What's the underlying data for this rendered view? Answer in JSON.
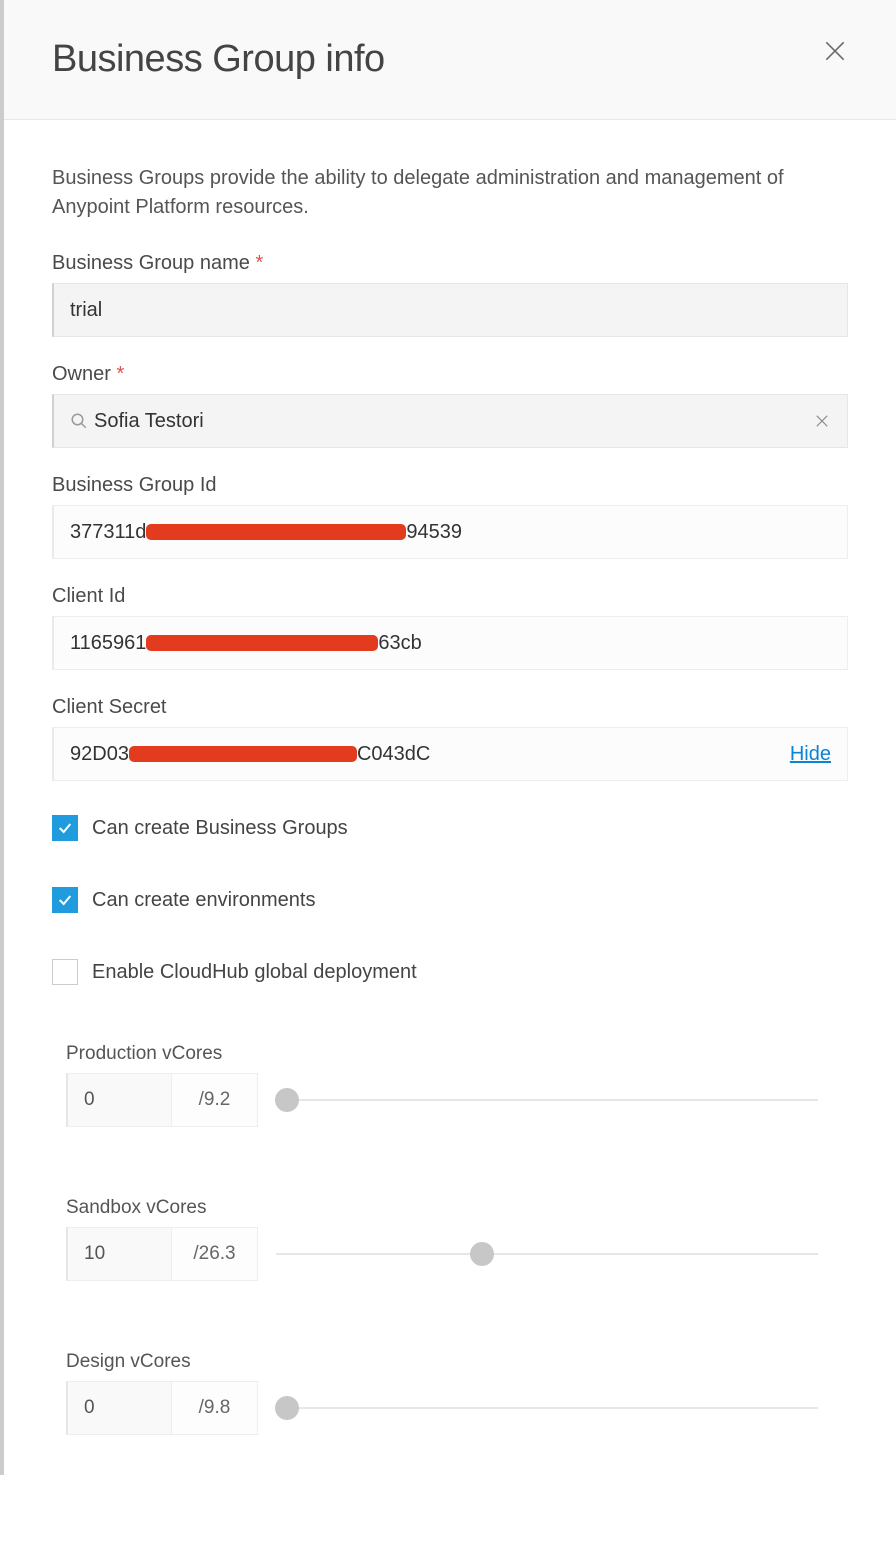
{
  "dialog": {
    "title": "Business Group info",
    "description": "Business Groups provide the ability to delegate administration and management of Anypoint Platform resources."
  },
  "fields": {
    "name": {
      "label": "Business Group name",
      "value": "trial"
    },
    "owner": {
      "label": "Owner",
      "value": "Sofia Testori"
    },
    "group_id": {
      "label": "Business Group Id",
      "prefix": "377311d",
      "suffix": "94539"
    },
    "client_id": {
      "label": "Client Id",
      "prefix": "1165961",
      "suffix": "63cb"
    },
    "client_secret": {
      "label": "Client Secret",
      "prefix": "92D03",
      "suffix": "C043dC",
      "toggle": "Hide"
    }
  },
  "checkboxes": {
    "create_bg": {
      "label": "Can create Business Groups",
      "checked": true
    },
    "create_env": {
      "label": "Can create environments",
      "checked": true
    },
    "global_deploy": {
      "label": "Enable CloudHub global deployment",
      "checked": false
    }
  },
  "sliders": {
    "production": {
      "label": "Production vCores",
      "value": "0",
      "max": "9.2",
      "pct": 2
    },
    "sandbox": {
      "label": "Sandbox vCores",
      "value": "10",
      "max": "26.3",
      "pct": 38
    },
    "design": {
      "label": "Design vCores",
      "value": "0",
      "max": "9.8",
      "pct": 2
    }
  }
}
